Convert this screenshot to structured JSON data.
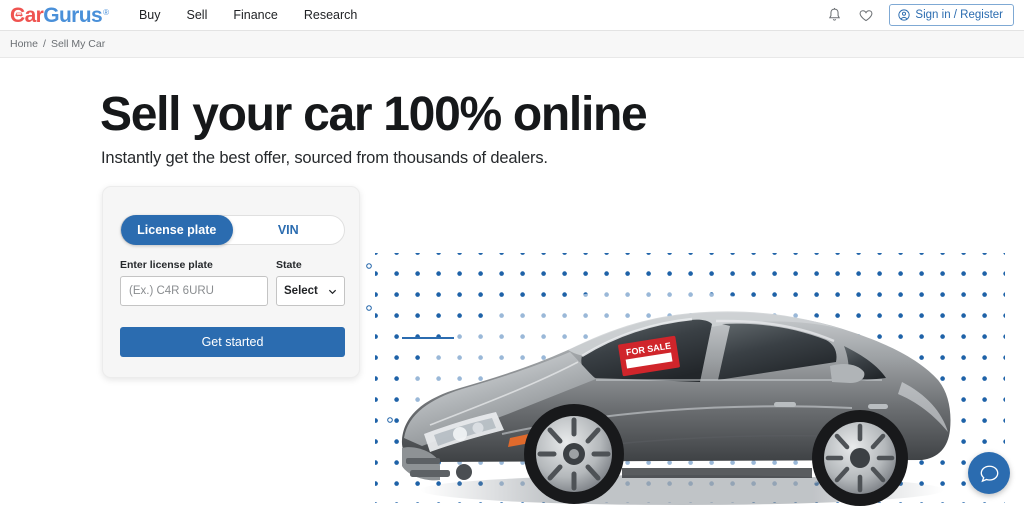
{
  "header": {
    "logo": {
      "part1": "Car",
      "part2": "Gurus",
      "trademark": "®",
      "icon": "car-icon"
    },
    "nav": [
      {
        "label": "Buy"
      },
      {
        "label": "Sell"
      },
      {
        "label": "Finance"
      },
      {
        "label": "Research"
      }
    ],
    "notifications_icon": "bell-icon",
    "favorites_icon": "heart-icon",
    "signin": {
      "label": "Sign in / Register",
      "icon": "user-circle-icon"
    }
  },
  "breadcrumb": {
    "home": "Home",
    "separator": "/",
    "current": "Sell My Car"
  },
  "hero": {
    "headline": "Sell your car 100% online",
    "subheadline": "Instantly get the best offer, sourced from thousands of dealers.",
    "sign_text": "FOR SALE"
  },
  "form": {
    "tabs": [
      {
        "label": "License plate",
        "active": true
      },
      {
        "label": "VIN",
        "active": false
      }
    ],
    "plate_label": "Enter license plate",
    "plate_placeholder": "(Ex.) C4R 6URU",
    "plate_value": "",
    "state_label": "State",
    "state_value": "Select",
    "state_chevron": "chevron-down-icon",
    "submit_label": "Get started"
  },
  "chat": {
    "icon": "chat-bubble-icon"
  },
  "colors": {
    "brand_blue": "#2b6cb0",
    "logo_red": "#ef5350",
    "logo_blue": "#4a90d9",
    "dot_blue": "#1e62a8",
    "sign_red": "#d0252b"
  }
}
